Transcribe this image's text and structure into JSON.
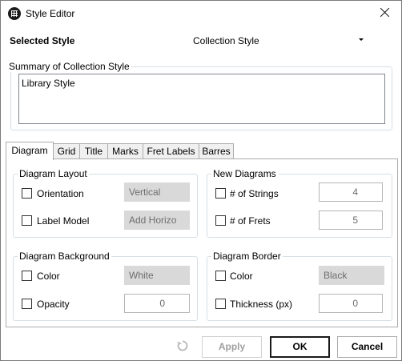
{
  "window": {
    "title": "Style Editor",
    "close_icon": "close-icon",
    "app_icon": "chord-grid-icon"
  },
  "selected_style": {
    "label": "Selected Style",
    "value": "Collection Style"
  },
  "summary": {
    "legend": "Summary of Collection Style",
    "text": "Library Style"
  },
  "tabs": [
    {
      "label": "Diagram",
      "active": true
    },
    {
      "label": "Grid"
    },
    {
      "label": "Title"
    },
    {
      "label": "Marks"
    },
    {
      "label": "Fret Labels"
    },
    {
      "label": "Barres"
    }
  ],
  "diagram_layout": {
    "legend": "Diagram Layout",
    "orientation": {
      "label": "Orientation",
      "value": "Vertical"
    },
    "label_model": {
      "label": "Label Model",
      "value": "Add Horizo"
    }
  },
  "new_diagrams": {
    "legend": "New Diagrams",
    "strings": {
      "label": "# of Strings",
      "value": "4"
    },
    "frets": {
      "label": "# of Frets",
      "value": "5"
    }
  },
  "diagram_background": {
    "legend": "Diagram Background",
    "color": {
      "label": "Color",
      "value": "White"
    },
    "opacity": {
      "label": "Opacity",
      "value": "0"
    }
  },
  "diagram_border": {
    "legend": "Diagram Border",
    "color": {
      "label": "Color",
      "value": "Black"
    },
    "thickness": {
      "label": "Thickness (px)",
      "value": "0"
    }
  },
  "buttons": {
    "apply": "Apply",
    "ok": "OK",
    "cancel": "Cancel",
    "reset_icon": "reset-icon"
  }
}
